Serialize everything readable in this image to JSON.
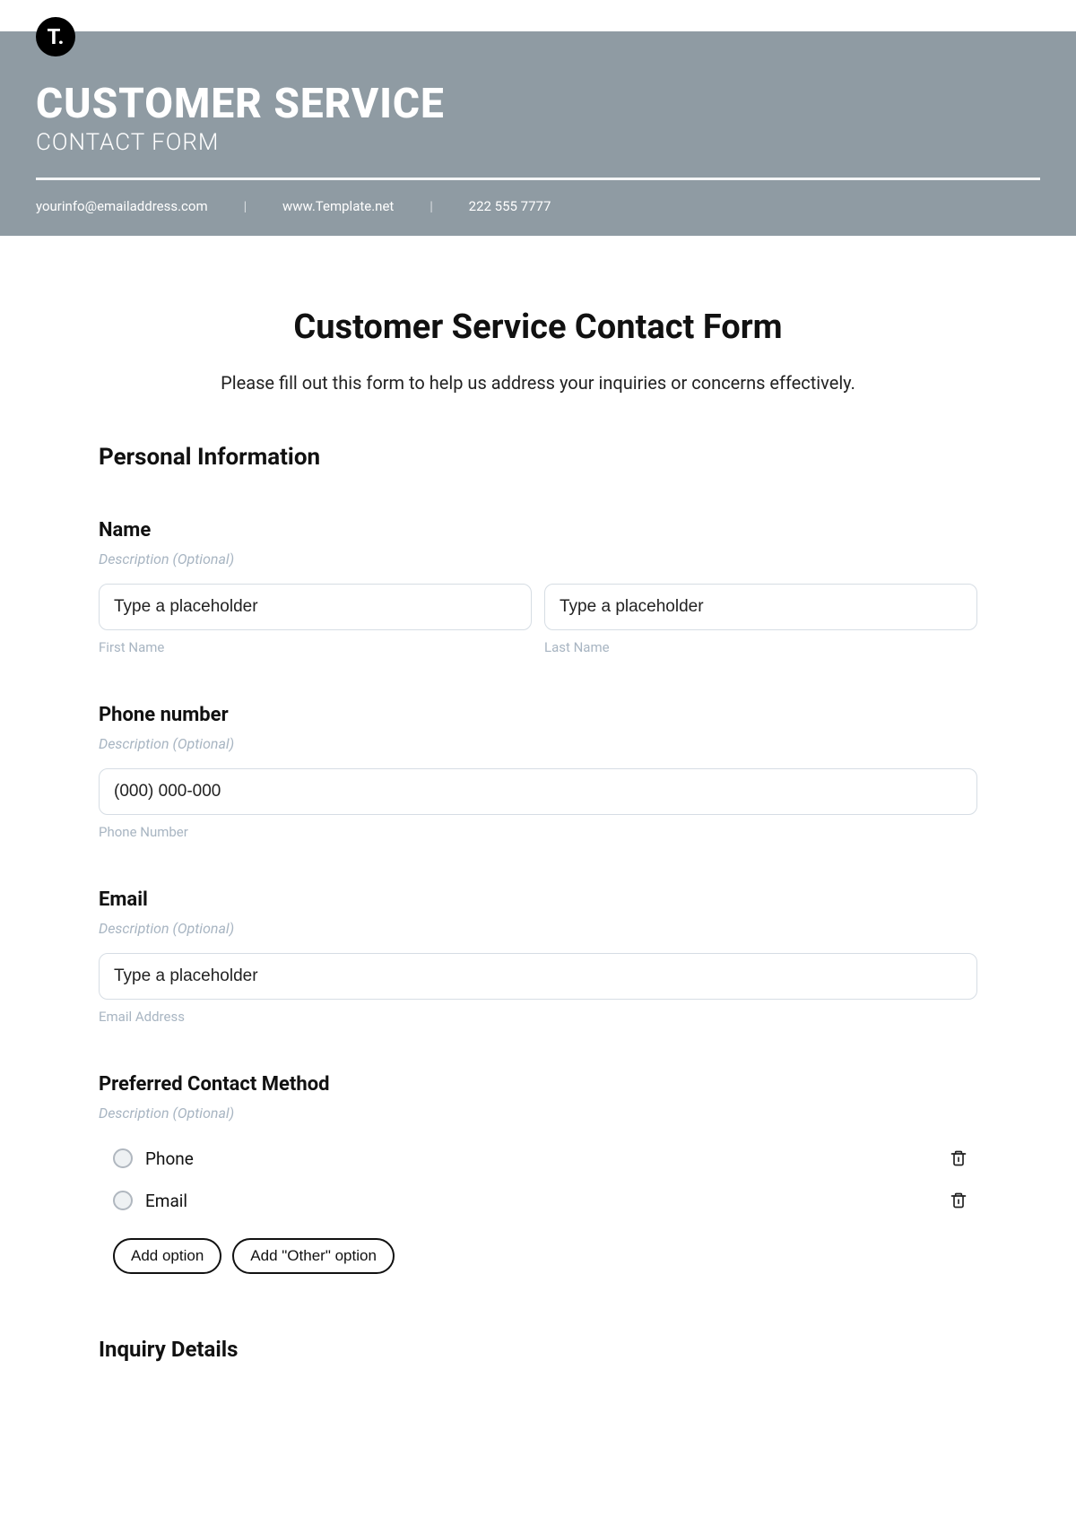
{
  "logo_text": "T.",
  "banner": {
    "title": "CUSTOMER SERVICE",
    "subtitle": "CONTACT FORM",
    "email": "yourinfo@emailaddress.com",
    "website": "www.Template.net",
    "phone": "222 555 7777",
    "divider": "|"
  },
  "form": {
    "title": "Customer Service Contact Form",
    "intro": "Please fill out this form to help us address your inquiries or concerns effectively.",
    "section_personal": "Personal Information",
    "name": {
      "label": "Name",
      "desc": "Description (Optional)",
      "first_placeholder": "Type a placeholder",
      "last_placeholder": "Type a placeholder",
      "first_sub": "First Name",
      "last_sub": "Last Name"
    },
    "phone": {
      "label": "Phone number",
      "desc": "Description (Optional)",
      "placeholder": "(000) 000-000",
      "sub": "Phone Number"
    },
    "email": {
      "label": "Email",
      "desc": "Description (Optional)",
      "placeholder": "Type a placeholder",
      "sub": "Email Address"
    },
    "contact_method": {
      "label": "Preferred Contact Method",
      "desc": "Description (Optional)",
      "options": [
        "Phone",
        "Email"
      ],
      "add_option": "Add option",
      "add_other": "Add \"Other\" option"
    },
    "section_inquiry": "Inquiry Details"
  }
}
